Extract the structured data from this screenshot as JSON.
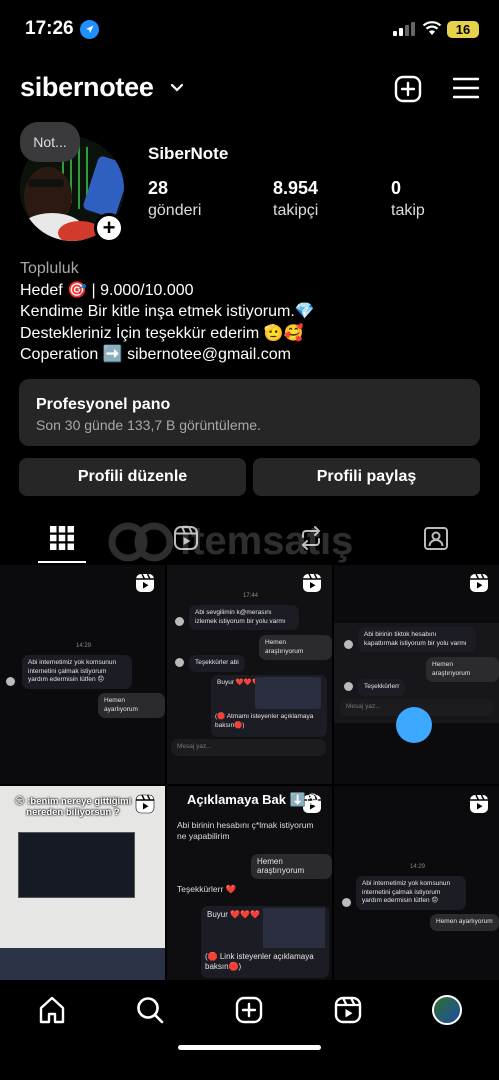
{
  "status": {
    "time": "17:26",
    "battery": "16"
  },
  "header": {
    "username": "sibernotee"
  },
  "profile": {
    "note": "Not...",
    "display_name": "SiberNote",
    "stats": [
      {
        "value": "28",
        "label": "gönderi"
      },
      {
        "value": "8.954",
        "label": "takipçi"
      },
      {
        "value": "0",
        "label": "takip"
      }
    ],
    "bio": {
      "category": "Topluluk",
      "line1": "Hedef 🎯 | 9.000/10.000",
      "line2": "Kendime Bir kitle inşa etmek istiyorum.💎",
      "line3": "Destekleriniz İçin teşekkür ederim 🫡🥰",
      "line4": "Coperation ➡️ sibernotee@gmail.com"
    }
  },
  "pro_panel": {
    "title": "Profesyonel pano",
    "subtitle": "Son 30 günde 133,7 B görüntüleme."
  },
  "buttons": {
    "edit": "Profili düzenle",
    "share": "Profili paylaş"
  },
  "watermark": "itemsatış",
  "posts": {
    "p1": {
      "time": "14:29",
      "msg": "Abi internetimiz yok komsunun internetini çalmak istiyorum yardım edermisin lütfen 😞",
      "reply": "Hemen ayarlıyorum"
    },
    "p2": {
      "time": "17:44",
      "msg": "Abi sevgilimin k@merasını izlemek istiyorum bir yolu varmı",
      "reply": "Hemen araştırıyorum",
      "thanks": "Teşekkürler abi",
      "buy": "Buyur ❤️❤️❤️",
      "caption": "(🛑 Atmamı isteyenler açıklamaya baksın🛑)",
      "input": "Mesaj yaz..."
    },
    "p3": {
      "msg": "Abi birinin tiktok hesabını kapattırmak istiyorum bir yolu varmı",
      "reply": "Hemen araştırıyorum",
      "thanks": "Teşekkürlerr",
      "input": "Mesaj yaz..."
    },
    "p4": {
      "text": "😏 :benim nereye gittiğimi nereden biliyorsun ?"
    },
    "p5": {
      "title": "Açıklamaya Bak ⬇️😘",
      "msg": "Abi birinin hesabını ç*lmak istiyorum ne yapabilirim",
      "reply": "Hemen araştırıyorum",
      "thanks": "Teşekkürlerr ❤️",
      "buy": "Buyur ❤️❤️❤️",
      "caption": "(🛑 Link isteyenler açıklamaya baksın🛑)"
    },
    "p6": {
      "time": "14:29",
      "msg": "Abi internetimiz yok komsunun internetini çalmak istiyorum yardım edermisin lütfen 😞",
      "reply": "Hemen ayarlıyorum"
    }
  }
}
